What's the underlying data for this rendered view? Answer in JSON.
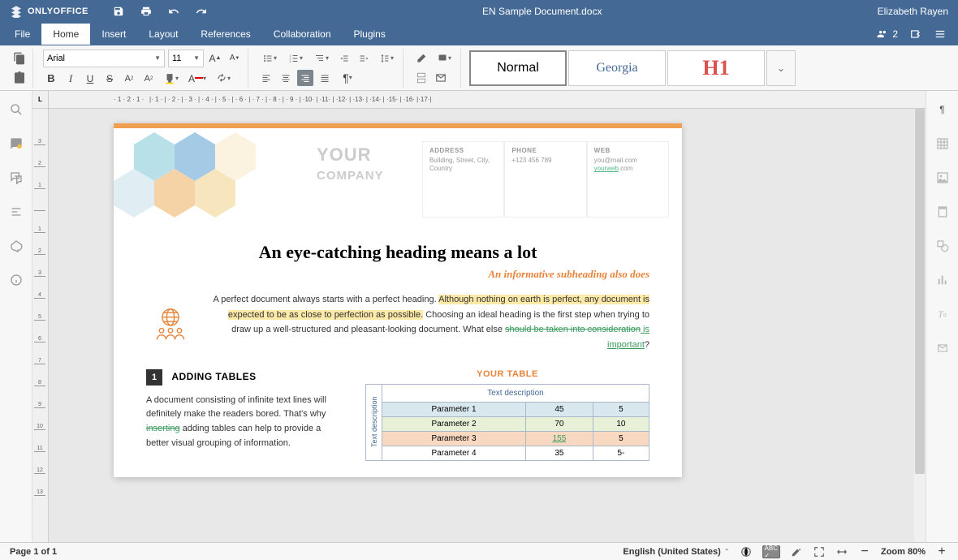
{
  "app": {
    "name": "ONLYOFFICE",
    "doc_title": "EN Sample Document.docx",
    "user": "Elizabeth Rayen",
    "user_count": "2"
  },
  "menu": {
    "items": [
      "File",
      "Home",
      "Insert",
      "Layout",
      "References",
      "Collaboration",
      "Plugins"
    ],
    "active": 1
  },
  "toolbar": {
    "font_name": "Arial",
    "font_size": "11",
    "styles": {
      "normal": "Normal",
      "georgia": "Georgia",
      "h1": "H1"
    }
  },
  "ruler": {
    "corner": "L"
  },
  "document": {
    "company": {
      "line1": "YOUR",
      "line2": "COMPANY"
    },
    "info": {
      "address": {
        "label": "ADDRESS",
        "value": "Building, Street, City, Country"
      },
      "phone": {
        "label": "PHONE",
        "value": "+123 456 789"
      },
      "web": {
        "label": "WEB",
        "email": "you@mail.com",
        "site_link": "yourweb",
        "site_tail": ".com"
      }
    },
    "h1": "An eye-catching heading means a lot",
    "h2": "An informative subheading also does",
    "para_segments": {
      "a": "A perfect document always starts with a perfect heading. ",
      "b": "Although nothing on earth is perfect, any document is expected to be as close to perfection as possible.",
      "c": " Choosing an ideal heading is the first step when trying to draw up a well-structured and pleasant-looking document. What else ",
      "d": "should be taken into consideration",
      "e": " is important",
      "f": "?"
    },
    "section": {
      "num": "1",
      "title": "ADDING TABLES",
      "text_a": "A document consisting of infinite text lines will definitely make the readers bored. That's why ",
      "text_strike": "inserting",
      "text_b": " adding tables can help to provide a better visual grouping of information."
    },
    "table": {
      "title": "YOUR TABLE",
      "hdr": "Text description",
      "vhdr": "Text description",
      "rows": [
        {
          "p": "Parameter 1",
          "v1": "45",
          "v2": "5"
        },
        {
          "p": "Parameter 2",
          "v1": "70",
          "v2": "10"
        },
        {
          "p": "Parameter 3",
          "v1": "155",
          "v2": "5",
          "tracked": true
        },
        {
          "p": "Parameter 4",
          "v1": "35",
          "v2": "5-"
        }
      ]
    }
  },
  "status": {
    "page": "Page 1 of 1",
    "lang": "English (United States)",
    "zoom": "Zoom 80%"
  }
}
